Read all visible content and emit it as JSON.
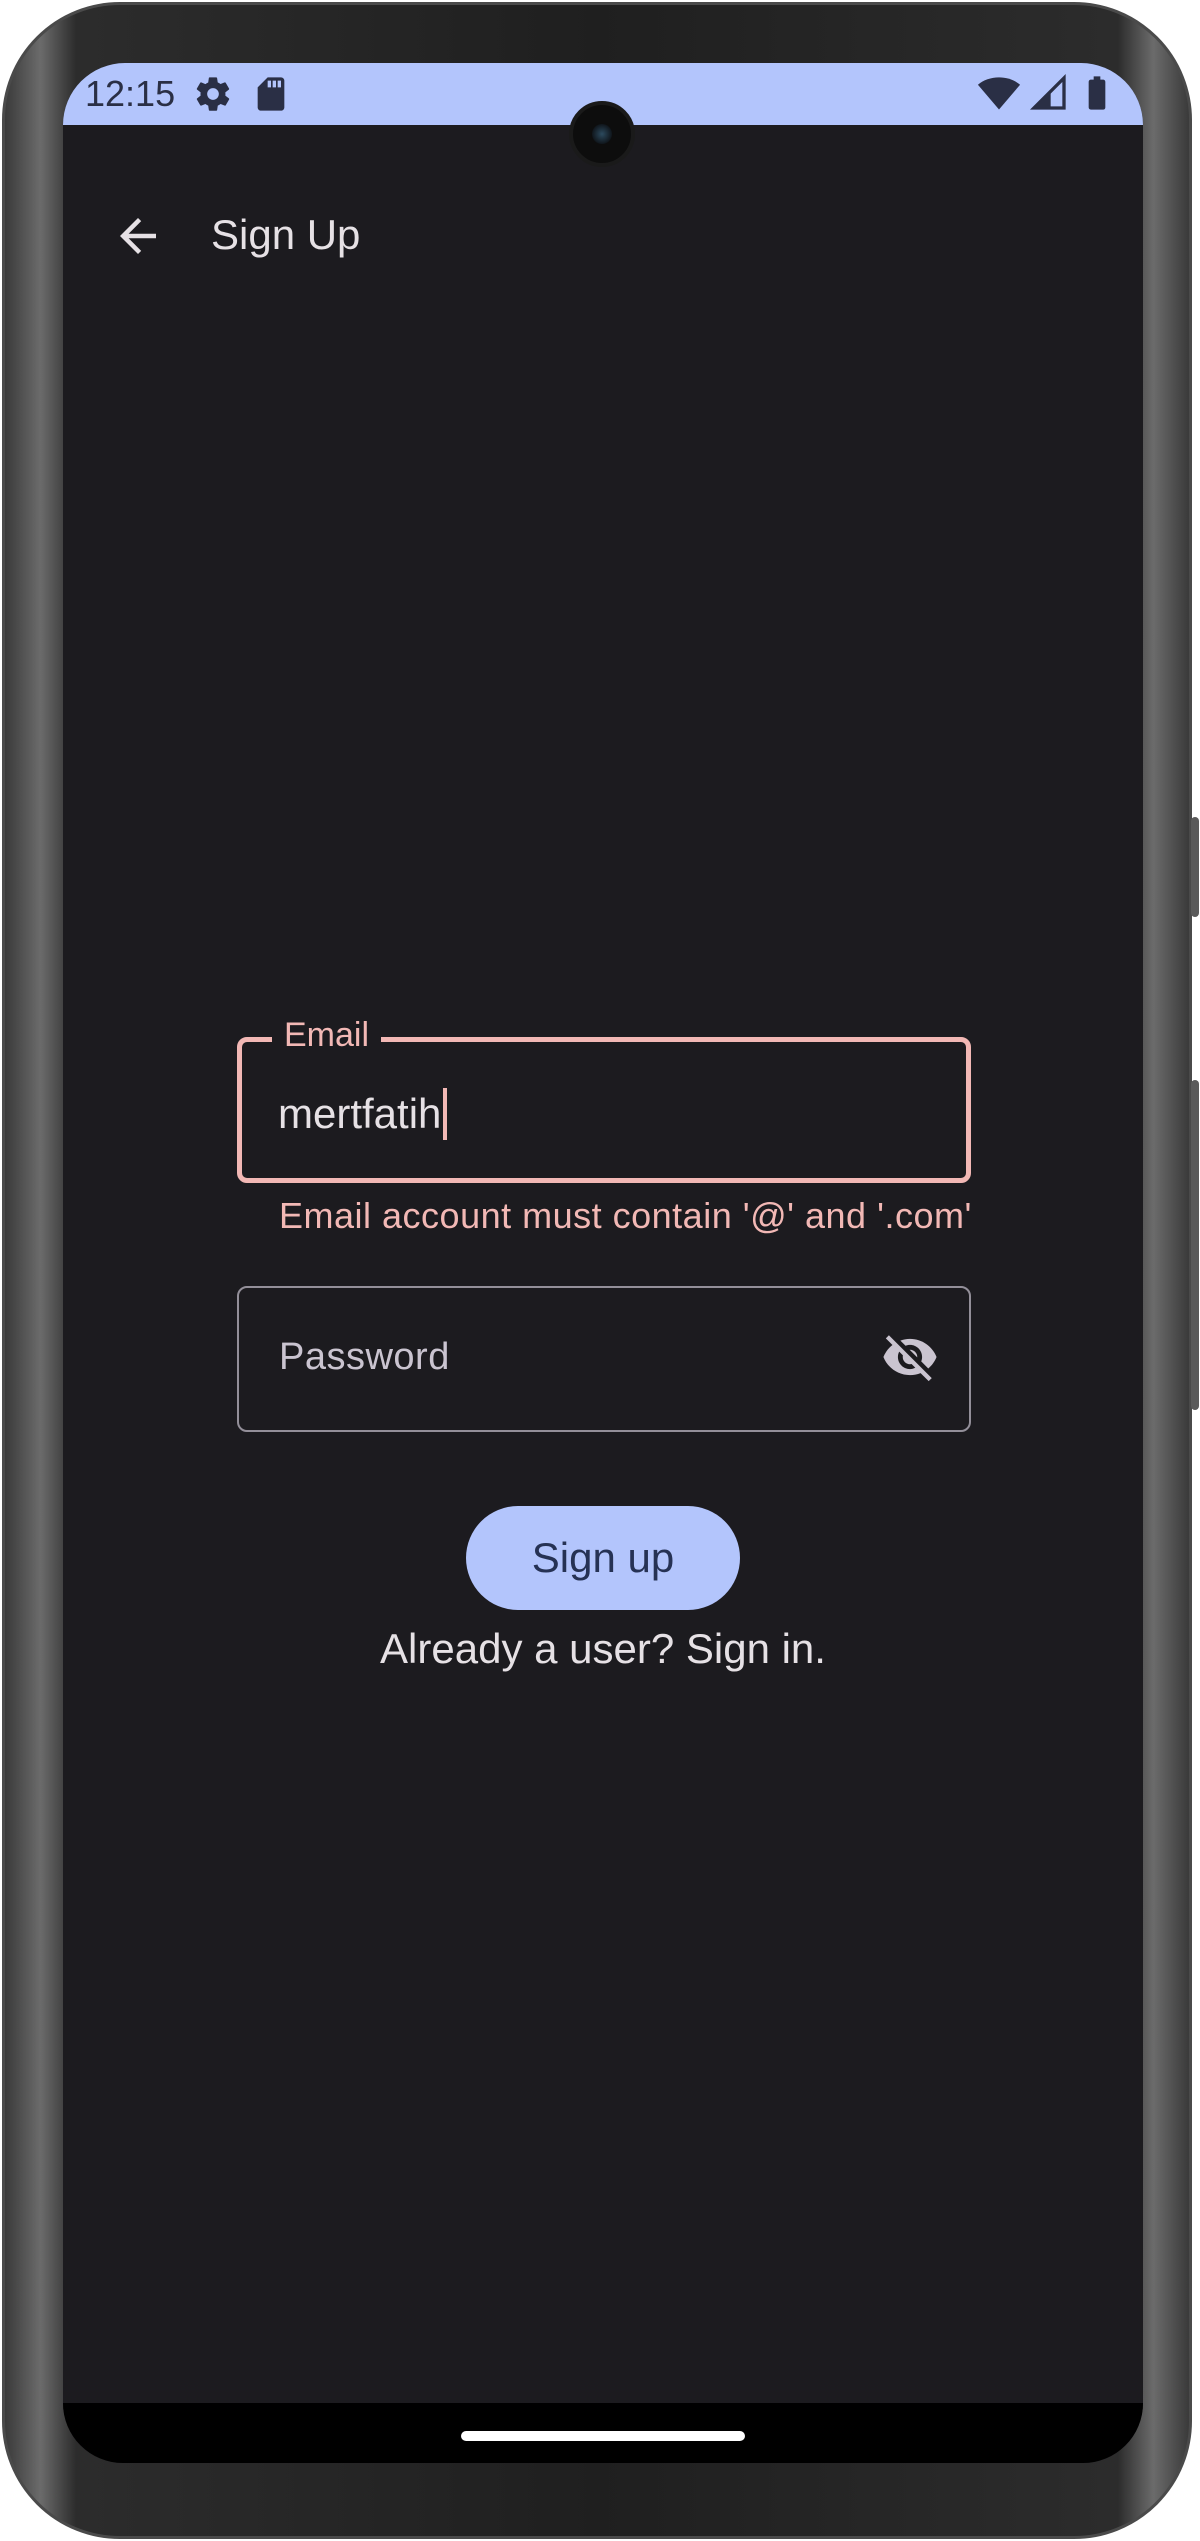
{
  "status_bar": {
    "time": "12:15",
    "icons": [
      "gear-icon",
      "sd-card-icon",
      "wifi-icon",
      "signal-icon",
      "battery-icon"
    ]
  },
  "top_bar": {
    "title": "Sign Up",
    "back_icon": "arrow-back-icon"
  },
  "form": {
    "email": {
      "label": "Email",
      "value": "mertfatih",
      "error": "Email account must contain '@' and '.com'"
    },
    "password": {
      "placeholder": "Password",
      "toggle_icon": "visibility-off-icon"
    },
    "submit_label": "Sign up",
    "signin_link": "Already a user? Sign in."
  },
  "colors": {
    "background": "#1c1b1f",
    "primary": "#b3c5fc",
    "error": "#f2b8b5",
    "on_surface": "#e6e1e5",
    "outline": "#938f99"
  }
}
